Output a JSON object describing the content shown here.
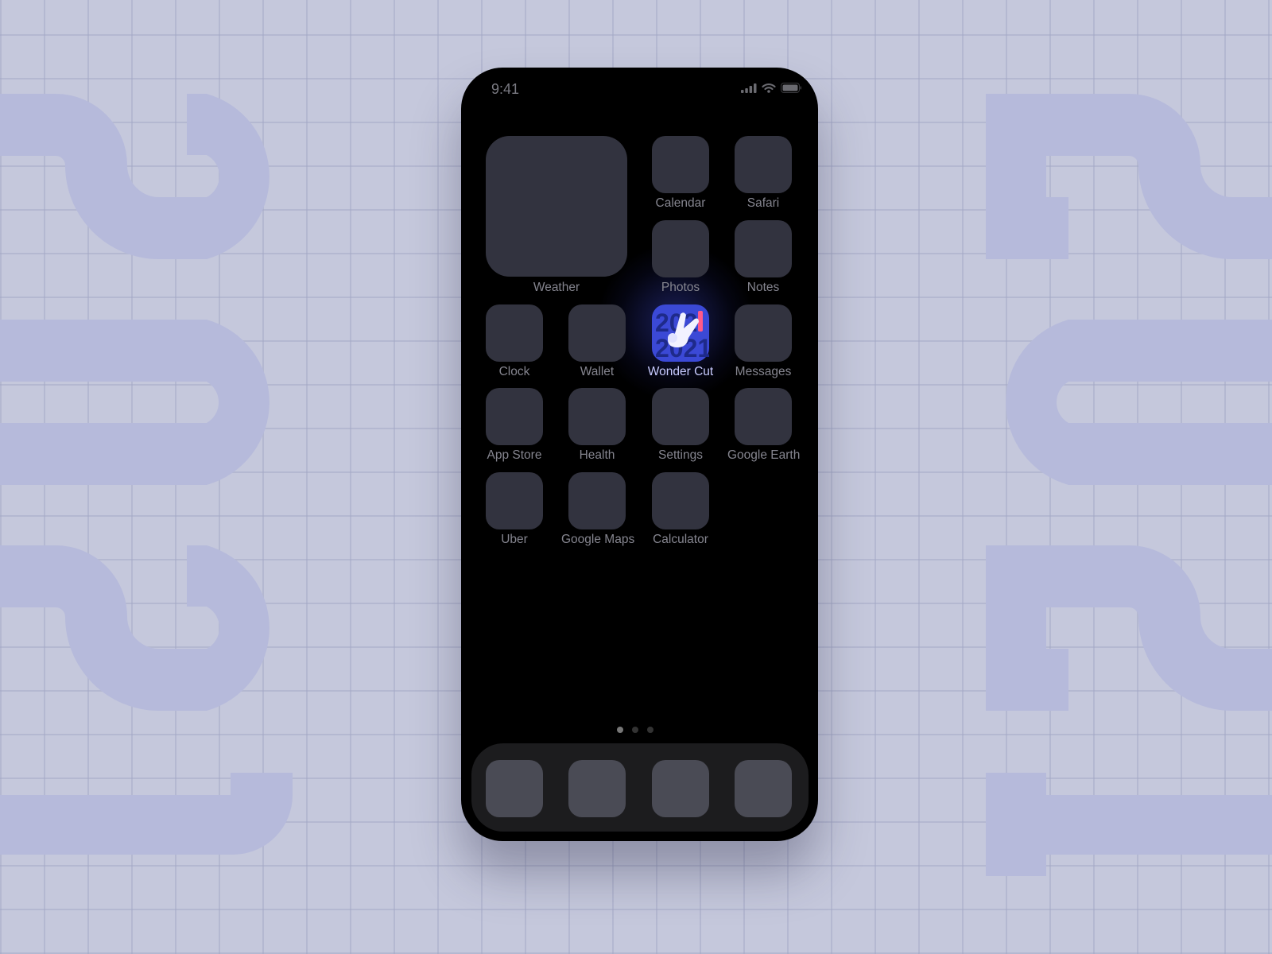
{
  "status_bar": {
    "time": "9:41",
    "icons": [
      "signal-icon",
      "wifi-icon",
      "battery-icon"
    ]
  },
  "widget": {
    "label": "Weather"
  },
  "apps": [
    {
      "label": "Calendar"
    },
    {
      "label": "Safari"
    },
    {
      "label": "Photos"
    },
    {
      "label": "Notes"
    },
    {
      "label": "Clock"
    },
    {
      "label": "Wallet"
    },
    {
      "label": "Wonder Cut",
      "highlighted": true
    },
    {
      "label": "Messages"
    },
    {
      "label": "App Store"
    },
    {
      "label": "Health"
    },
    {
      "label": "Settings"
    },
    {
      "label": "Google Earth"
    },
    {
      "label": "Uber"
    },
    {
      "label": "Google Maps"
    },
    {
      "label": "Calculator"
    }
  ],
  "page_indicator": {
    "pages": 3,
    "current": 1
  },
  "dock": {
    "count": 4
  },
  "colors": {
    "background": "#c5c8dc",
    "icon": "#32333f",
    "dock_icon": "#4a4b55",
    "accent": "#3b49d6",
    "highlight_label": "#c9ccff"
  }
}
